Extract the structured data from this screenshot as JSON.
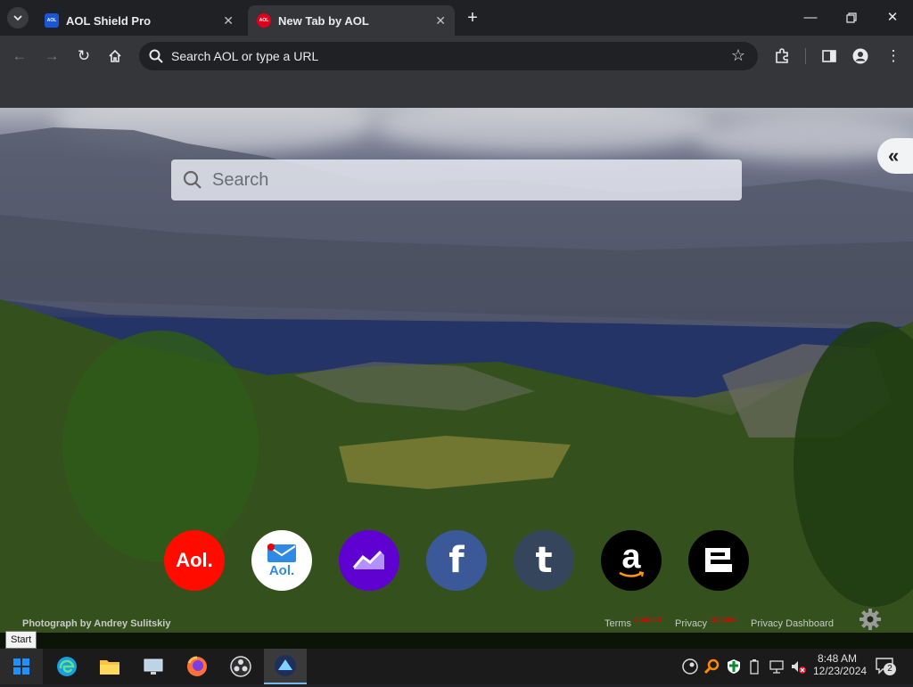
{
  "browser": {
    "tabs": [
      {
        "title": "AOL Shield Pro",
        "favicon": "aol-shield-favicon",
        "active": false
      },
      {
        "title": "New Tab by AOL",
        "favicon": "aol-favicon",
        "active": true
      }
    ],
    "omnibox_placeholder": "Search AOL or type a URL"
  },
  "page": {
    "search_placeholder": "Search",
    "sites": [
      {
        "name": "AOL",
        "label": "Aol.",
        "color": "#ff0b00"
      },
      {
        "name": "AOL Mail",
        "label": "Aol.",
        "color": "#ffffff"
      },
      {
        "name": "Yahoo Finance",
        "icon": "chart-icon",
        "color": "#5f01d1"
      },
      {
        "name": "Facebook",
        "label": "f",
        "color": "#3b5998"
      },
      {
        "name": "Tumblr",
        "label": "t",
        "color": "#35465c"
      },
      {
        "name": "Amazon",
        "label": "a",
        "color": "#000000"
      },
      {
        "name": "Engadget",
        "label": "e",
        "color": "#000000"
      }
    ],
    "photo_credit": "Photograph by Andrey Sulitskiy",
    "footer_links": [
      {
        "label": "Terms",
        "badge": "Updated"
      },
      {
        "label": "Privacy",
        "badge": "Updated"
      },
      {
        "label": "Privacy Dashboard"
      }
    ]
  },
  "taskbar": {
    "start_tooltip": "Start",
    "time": "8:48 AM",
    "date": "12/23/2024",
    "notification_count": "2"
  }
}
